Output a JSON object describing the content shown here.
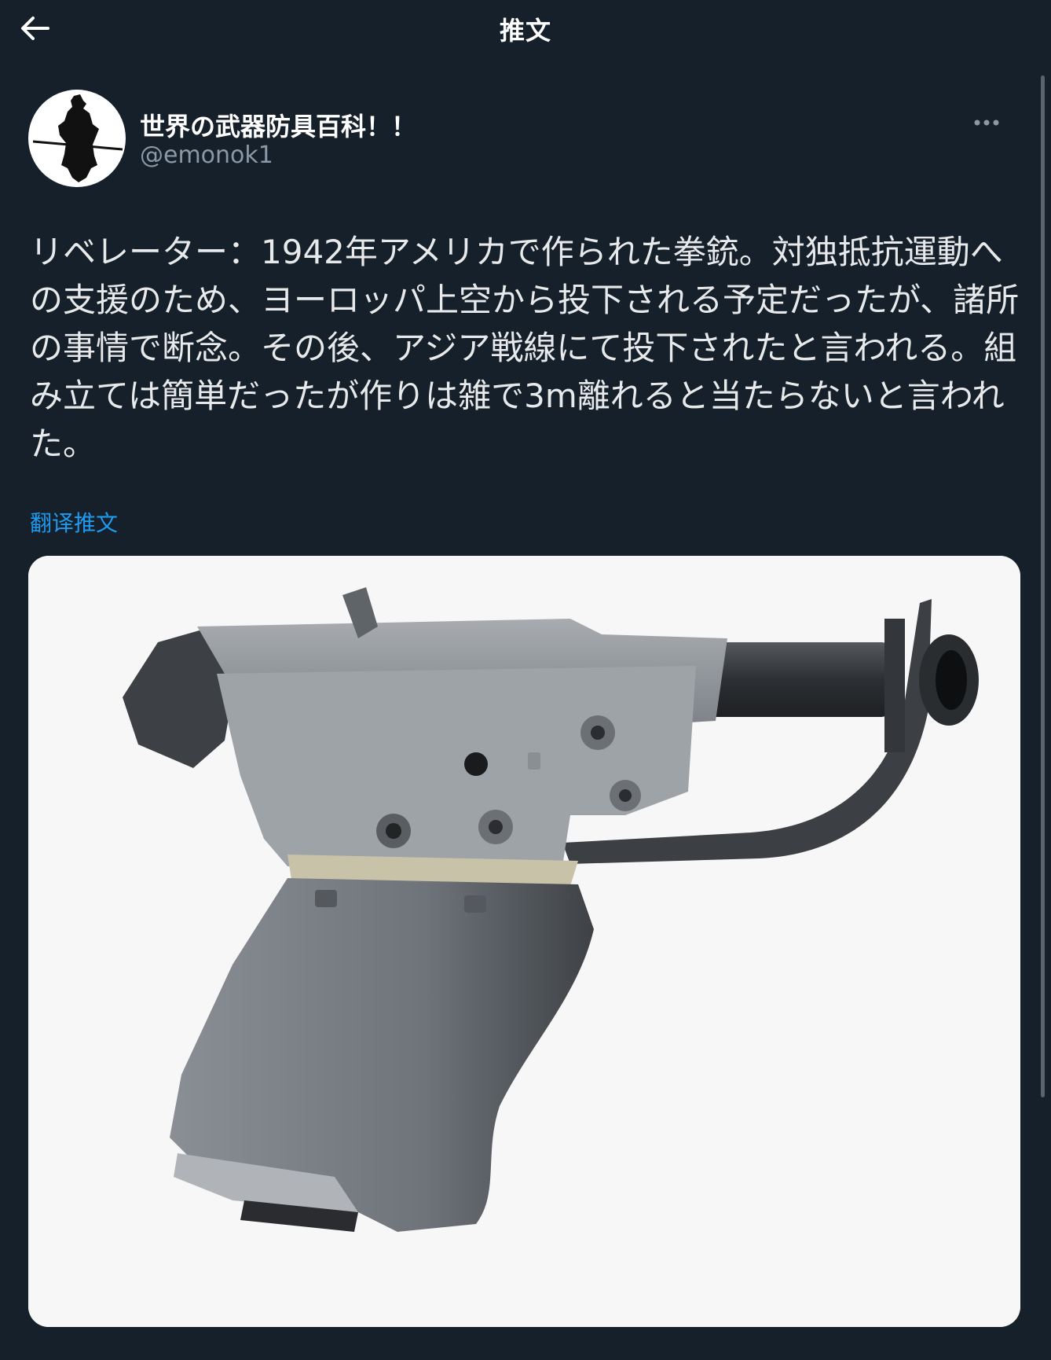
{
  "header": {
    "title": "推文",
    "back_icon": "arrow-left-icon"
  },
  "tweet": {
    "display_name": "世界の武器防具百科！！",
    "handle": "@emonok1",
    "text": "リベレーター：1942年アメリカで作られた拳銃。対独抵抗運動への支援のため、ヨーロッパ上空から投下される予定だったが、諸所の事情で断念。その後、アジア戦線にて投下されたと言われる。組み立ては簡単だったが作りは雑で3m離れると当たらないと言われた。",
    "translate_label": "翻译推文",
    "more_icon": "more-options-icon"
  },
  "colors": {
    "background": "#15202b",
    "text": "#e7e9ea",
    "secondary": "#8b98a5",
    "link": "#1d9bf0"
  }
}
